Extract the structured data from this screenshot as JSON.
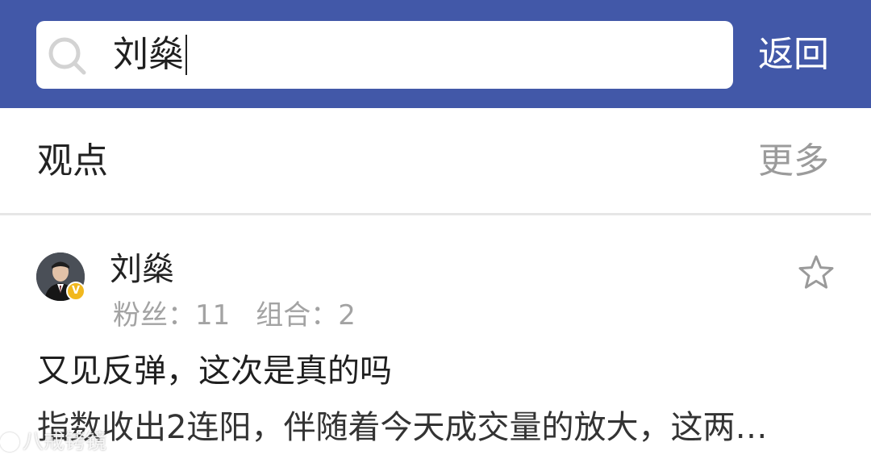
{
  "header": {
    "search_value": "刘燊",
    "back_label": "返回"
  },
  "section": {
    "title": "观点",
    "more_label": "更多"
  },
  "card": {
    "author_name": "刘燊",
    "verified_mark": "V",
    "followers_label": "粉丝：",
    "followers_count": "11",
    "groups_label": "组合：",
    "groups_count": "2",
    "post_title": "又见反弹，这次是真的吗",
    "post_summary": "指数收出2连阳，伴随着今天成交量的放大，这两…"
  },
  "watermark": {
    "text": "八戒铐镜"
  },
  "icons": {
    "search": "search-icon",
    "star": "star-outline-icon",
    "verified": "verified-badge-icon"
  },
  "colors": {
    "header_bg": "#4258a8",
    "accent_badge": "#f1b81e",
    "muted_text": "#9b9b9b"
  }
}
